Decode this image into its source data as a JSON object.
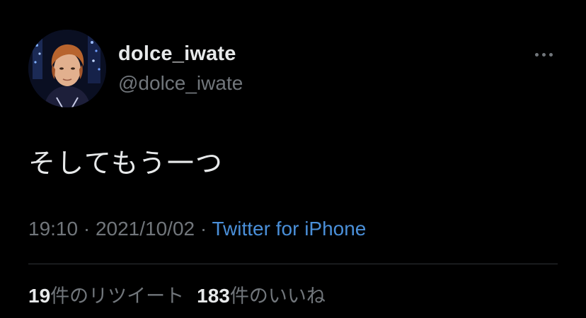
{
  "tweet": {
    "display_name": "dolce_iwate",
    "handle": "@dolce_iwate",
    "text": "そしてもう一つ",
    "time": "19:10",
    "separator": "·",
    "date": "2021/10/02",
    "source": "Twitter for iPhone",
    "retweets": {
      "count": "19",
      "label": "件のリツイート"
    },
    "likes": {
      "count": "183",
      "label": "件のいいね"
    }
  },
  "icons": {
    "more": "more-horizontal-icon",
    "avatar": "profile-photo"
  },
  "colors": {
    "background": "#000000",
    "primary_text": "#e7e9ea",
    "secondary_text": "#71767b",
    "link": "#4a8fd8",
    "divider": "#2f3336"
  }
}
